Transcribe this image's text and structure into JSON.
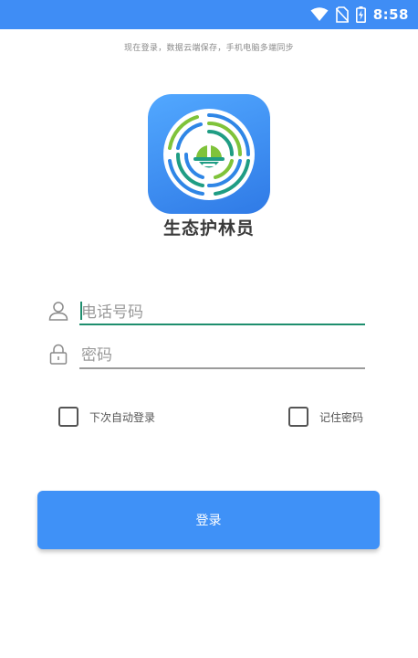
{
  "status_bar": {
    "time": "8:58",
    "background_color": "#3f8df5",
    "icons": [
      "wifi-icon",
      "no-sim-icon",
      "battery-charging-icon"
    ]
  },
  "header": {
    "subtitle": "现在登录，数据云端保存，手机电脑多端同步"
  },
  "app": {
    "name": "生态护林员",
    "logo_icon": "forest-ranger-helmet-logo"
  },
  "form": {
    "phone": {
      "placeholder": "电话号码",
      "value": "",
      "icon": "user-icon",
      "focused": true
    },
    "password": {
      "placeholder": "密码",
      "value": "",
      "icon": "lock-icon"
    },
    "auto_login": {
      "label": "下次自动登录",
      "checked": false
    },
    "remember_password": {
      "label": "记住密码",
      "checked": false
    },
    "submit_label": "登录"
  },
  "colors": {
    "accent": "#3f91f7",
    "focus_underline": "#1e8e6e"
  }
}
